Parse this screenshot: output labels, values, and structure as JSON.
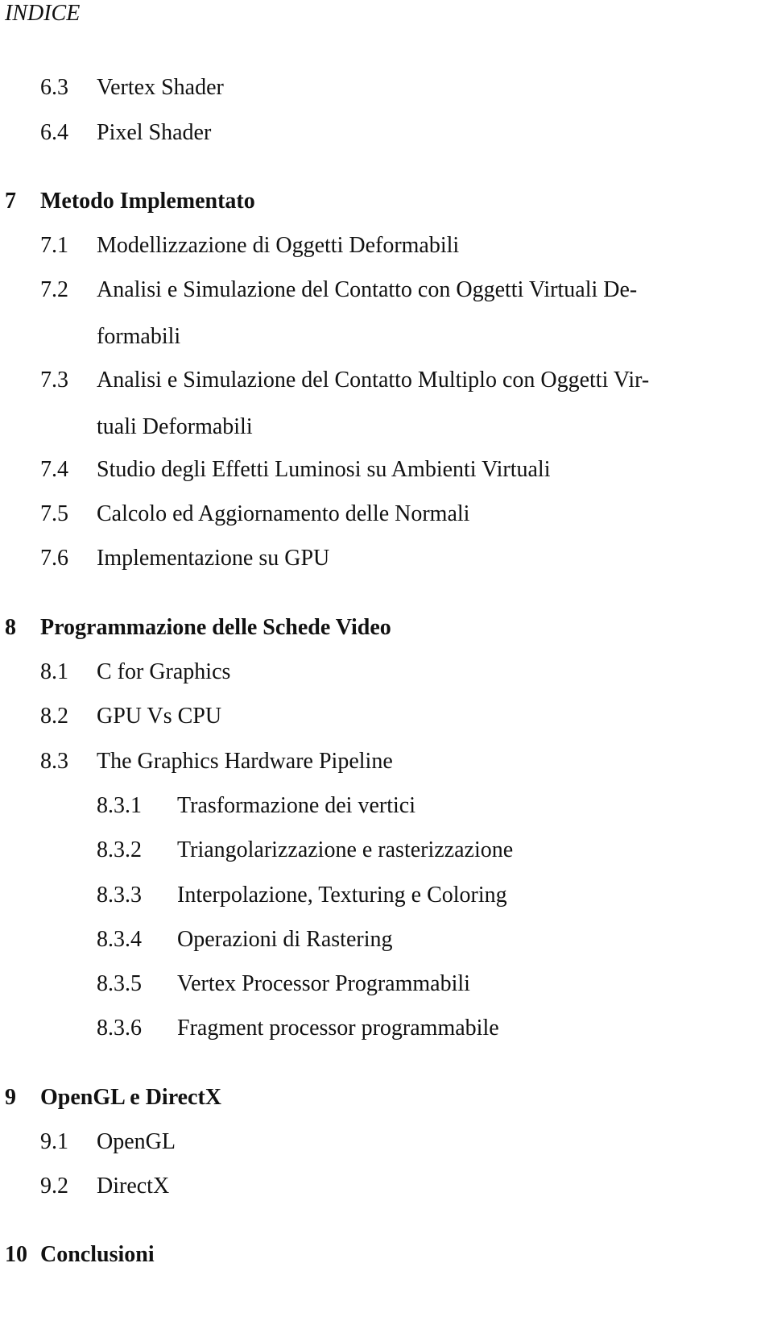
{
  "header": {
    "title": "INDICE"
  },
  "toc": {
    "s6_3": {
      "num": "6.3",
      "title": "Vertex Shader"
    },
    "s6_4": {
      "num": "6.4",
      "title": "Pixel Shader"
    },
    "c7": {
      "num": "7",
      "title": "Metodo Implementato"
    },
    "s7_1": {
      "num": "7.1",
      "title": "Modellizzazione di Oggetti Deformabili"
    },
    "s7_2": {
      "num": "7.2",
      "title": "Analisi e Simulazione del Contatto con Oggetti Virtuali De-",
      "cont": "formabili"
    },
    "s7_3": {
      "num": "7.3",
      "title": "Analisi e Simulazione del Contatto Multiplo con Oggetti Vir-",
      "cont": "tuali Deformabili"
    },
    "s7_4": {
      "num": "7.4",
      "title": "Studio degli Effetti Luminosi su Ambienti Virtuali"
    },
    "s7_5": {
      "num": "7.5",
      "title": "Calcolo ed Aggiornamento delle Normali"
    },
    "s7_6": {
      "num": "7.6",
      "title": "Implementazione su GPU"
    },
    "c8": {
      "num": "8",
      "title": "Programmazione delle Schede Video"
    },
    "s8_1": {
      "num": "8.1",
      "title": "C for Graphics"
    },
    "s8_2": {
      "num": "8.2",
      "title": "GPU Vs CPU"
    },
    "s8_3": {
      "num": "8.3",
      "title": "The Graphics Hardware Pipeline"
    },
    "s8_3_1": {
      "num": "8.3.1",
      "title": "Trasformazione dei vertici"
    },
    "s8_3_2": {
      "num": "8.3.2",
      "title": "Triangolarizzazione e rasterizzazione"
    },
    "s8_3_3": {
      "num": "8.3.3",
      "title": "Interpolazione, Texturing e Coloring"
    },
    "s8_3_4": {
      "num": "8.3.4",
      "title": "Operazioni di Rastering"
    },
    "s8_3_5": {
      "num": "8.3.5",
      "title": "Vertex Processor Programmabili"
    },
    "s8_3_6": {
      "num": "8.3.6",
      "title": "Fragment processor programmabile"
    },
    "c9": {
      "num": "9",
      "title": "OpenGL e DirectX"
    },
    "s9_1": {
      "num": "9.1",
      "title": "OpenGL"
    },
    "s9_2": {
      "num": "9.2",
      "title": "DirectX"
    },
    "c10": {
      "num": "10",
      "title": "Conclusioni"
    }
  }
}
